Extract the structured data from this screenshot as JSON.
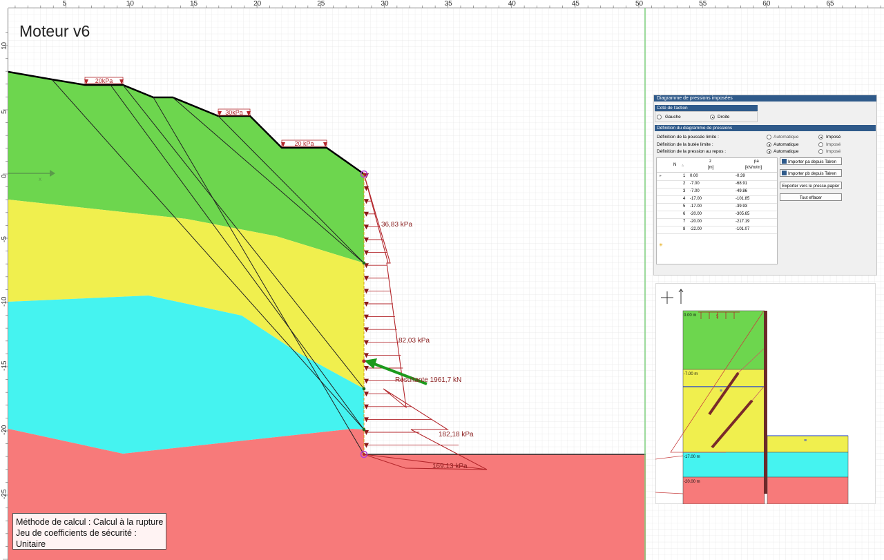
{
  "title": "Moteur v6",
  "axis_x_labels": [
    "5",
    "10",
    "15",
    "20",
    "25",
    "30",
    "35",
    "40",
    "45",
    "50",
    "55",
    "60",
    "65"
  ],
  "axis_y_labels": [
    "10",
    "5",
    "0",
    "-5",
    "-10",
    "-15",
    "-20",
    "-25"
  ],
  "surface_loads": [
    "20kPa",
    "30kPa",
    "20 kPa"
  ],
  "pressure_labels": [
    "36,83 kPa",
    "82,03 kPa",
    "182,18 kPa",
    "169,13 kPa"
  ],
  "resultant_label": "Resultante 1961,7 kN",
  "calc_method": "Méthode de calcul : Calcul à la rupture",
  "safety_set": "Jeu de coefficients de sécurité : Unitaire",
  "colors": {
    "layer1": "#6dd64e",
    "layer2": "#f0ef4e",
    "layer3": "#45f3f0",
    "layer4": "#f77a7a",
    "pressure": "#b3262b",
    "resultant": "#1c9a1c",
    "grid": "#e4e4e4",
    "panelBar": "#2f5a8a"
  },
  "panel": {
    "title": "Diagramme de pressions imposées",
    "side_section": "Coté de l'action",
    "side_left": "Gauche",
    "side_right": "Droite",
    "def_section": "Définition du diagramme de pressions",
    "row1": "Définition de la poussée limite :",
    "row2": "Définition de la butée limite :",
    "row3": "Définition de la pression au repos :",
    "opt_auto": "Automatique",
    "opt_imposed": "Imposé",
    "col_n": "N",
    "col_z": "z",
    "col_z_unit": "[m]",
    "col_pa": "pa",
    "col_pa_unit": "[kN/m/m]",
    "rows": [
      {
        "n": "1",
        "z": "0.00",
        "pa": "-0.39"
      },
      {
        "n": "2",
        "z": "-7.00",
        "pa": "-68.91"
      },
      {
        "n": "3",
        "z": "-7.00",
        "pa": "-49.86"
      },
      {
        "n": "4",
        "z": "-17.00",
        "pa": "-101.85"
      },
      {
        "n": "5",
        "z": "-17.00",
        "pa": "-39.93"
      },
      {
        "n": "6",
        "z": "-20.00",
        "pa": "-305.65"
      },
      {
        "n": "7",
        "z": "-20.00",
        "pa": "-217.19"
      },
      {
        "n": "8",
        "z": "-22.00",
        "pa": "-101.07"
      }
    ],
    "btn_import_pa": "Importer pa depuis Talren",
    "btn_import_pb": "Importer pb depuis Talren",
    "btn_export": "Exporter vers le presse-papier",
    "btn_clear": "Tout effacer"
  },
  "mini": {
    "level0": "0.00 m",
    "level1": "-7.00 m",
    "level2": "-17.00 m",
    "level3": "-20.00 m",
    "load_label": "5",
    "axes_icon": "axes-icon"
  }
}
